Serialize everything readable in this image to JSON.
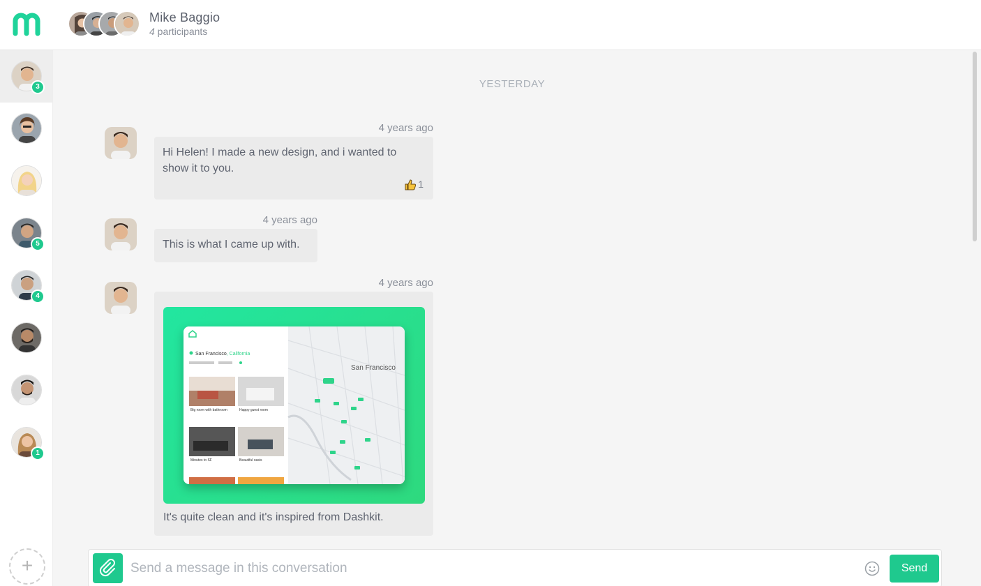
{
  "header": {
    "title": "Mike Baggio",
    "participants_count": "4",
    "participants_label": " participants"
  },
  "sidebar": {
    "rooms": [
      {
        "badge": "3",
        "active": true
      },
      {
        "badge": ""
      },
      {
        "badge": ""
      },
      {
        "badge": "5"
      },
      {
        "badge": "4"
      },
      {
        "badge": ""
      },
      {
        "badge": ""
      },
      {
        "badge": "1"
      }
    ],
    "add_label": "+"
  },
  "main": {
    "date_separator": "YESTERDAY",
    "messages": [
      {
        "time": "4 years ago",
        "text": "Hi Helen! I made a new design, and i wanted to show it to you.",
        "reaction_count": "1"
      },
      {
        "time": "4 years ago",
        "text": "This is what I came up with."
      },
      {
        "time": "4 years ago",
        "text": "It's quite clean and it's inspired from Dashkit."
      }
    ],
    "preview": {
      "city": "San Francisco",
      "state": ", California",
      "map_label": "San Francisco",
      "cards": [
        "Big room with bathroom",
        "Happy guest room",
        "Minutes to SF",
        "Beautiful oasis"
      ]
    }
  },
  "composer": {
    "placeholder": "Send a message in this conversation",
    "send_label": "Send"
  },
  "colors": {
    "accent": "#1fc98e",
    "background": "#f5f5f5",
    "bubble": "#ebebeb"
  }
}
